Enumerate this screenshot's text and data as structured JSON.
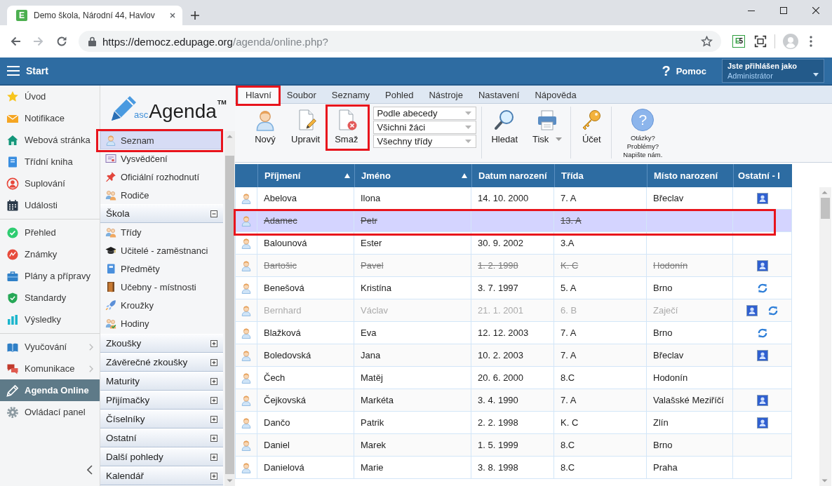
{
  "browser": {
    "tab": {
      "favicon": "E",
      "title": "Demo škola, Národní 44, Havlov"
    },
    "url": {
      "host": "https://democz.edupage.org",
      "path": "/agenda/online.php?"
    },
    "extension": "E5"
  },
  "app_bar": {
    "start": "Start",
    "help": {
      "glyph": "?",
      "label": "Pomoc"
    },
    "user": {
      "caption": "Jste přihlášen jako",
      "name": "Administrátor"
    }
  },
  "main_nav": {
    "groups": [
      [
        {
          "label": "Úvod",
          "selected": false,
          "submenu": false
        },
        {
          "label": "Notifikace",
          "selected": false,
          "submenu": false
        },
        {
          "label": "Webová stránka",
          "selected": false,
          "submenu": false
        },
        {
          "label": "Třídní kniha",
          "selected": false,
          "submenu": false
        },
        {
          "label": "Suplování",
          "selected": false,
          "submenu": false
        },
        {
          "label": "Události",
          "selected": false,
          "submenu": false
        }
      ],
      [
        {
          "label": "Přehled",
          "selected": false,
          "submenu": false
        },
        {
          "label": "Známky",
          "selected": false,
          "submenu": false
        },
        {
          "label": "Plány a přípravy",
          "selected": false,
          "submenu": false
        },
        {
          "label": "Standardy",
          "selected": false,
          "submenu": false
        },
        {
          "label": "Výsledky",
          "selected": false,
          "submenu": false
        }
      ],
      [
        {
          "label": "Vyučování",
          "selected": false,
          "submenu": true
        },
        {
          "label": "Komunikace",
          "selected": false,
          "submenu": true
        },
        {
          "label": "Agenda Online",
          "selected": true,
          "submenu": false
        },
        {
          "label": "Ovládací panel",
          "selected": false,
          "submenu": false
        }
      ]
    ]
  },
  "agenda_panel": {
    "logo": {
      "prefix": "asc",
      "name": "Agenda",
      "mark": "TM"
    },
    "items": [
      {
        "label": "Seznam",
        "selected": true,
        "highlighted": true
      },
      {
        "label": "Vysvědčení",
        "selected": false,
        "highlighted": false
      },
      {
        "label": "Oficiální rozhodnutí",
        "selected": false,
        "highlighted": false
      },
      {
        "label": "Rodiče",
        "selected": false,
        "highlighted": false
      }
    ],
    "groups": [
      {
        "label": "Škola",
        "expanded": true,
        "items": [
          {
            "label": "Třídy",
            "selected": false
          },
          {
            "label": "Učitelé - zaměstnanci",
            "selected": false
          },
          {
            "label": "Předměty",
            "selected": false
          },
          {
            "label": "Učebny - místnosti",
            "selected": false
          },
          {
            "label": "Kroužky",
            "selected": false
          },
          {
            "label": "Hodiny",
            "selected": false
          }
        ]
      },
      {
        "label": "Zkoušky",
        "expanded": false
      },
      {
        "label": "Závěrečné zkoušky",
        "expanded": false
      },
      {
        "label": "Maturity",
        "expanded": false
      },
      {
        "label": "Přijímačky",
        "expanded": false
      },
      {
        "label": "Číselníky",
        "expanded": false
      },
      {
        "label": "Ostatní",
        "expanded": false
      },
      {
        "label": "Další pohledy",
        "expanded": false
      },
      {
        "label": "Kalendář",
        "expanded": false
      }
    ]
  },
  "ribbon": {
    "tabs": [
      {
        "label": "Hlavní",
        "selected": true,
        "highlighted": true
      },
      {
        "label": "Soubor",
        "selected": false,
        "highlighted": false
      },
      {
        "label": "Seznamy",
        "selected": false,
        "highlighted": false
      },
      {
        "label": "Pohled",
        "selected": false,
        "highlighted": false
      },
      {
        "label": "Nástroje",
        "selected": false,
        "highlighted": false
      },
      {
        "label": "Nastavení",
        "selected": false,
        "highlighted": false
      },
      {
        "label": "Nápověda",
        "selected": false,
        "highlighted": false
      }
    ],
    "tools": [
      {
        "kind": "new",
        "label": "Nový",
        "highlighted": false,
        "menu": false
      },
      {
        "kind": "edit",
        "label": "Upravit",
        "highlighted": false,
        "menu": false
      },
      {
        "kind": "delete",
        "label": "Smaž",
        "highlighted": true,
        "menu": false
      },
      {
        "kind": "select",
        "value": "Podle abecedy"
      },
      {
        "kind": "select",
        "value": "Všichni žáci"
      },
      {
        "kind": "select",
        "value": "Všechny třídy"
      },
      {
        "kind": "separator"
      },
      {
        "kind": "search",
        "label": "Hledat",
        "highlighted": false,
        "menu": false
      },
      {
        "kind": "print",
        "label": "Tisk",
        "highlighted": false,
        "menu": true
      },
      {
        "kind": "separator"
      },
      {
        "kind": "account",
        "label": "Účet",
        "highlighted": false,
        "menu": false
      },
      {
        "kind": "separator"
      },
      {
        "kind": "help",
        "glyph": "?",
        "lines": [
          "Otázky?",
          "Problémy?",
          "Napište nám."
        ]
      }
    ]
  },
  "table": {
    "columns": [
      {
        "label": "Příjmení",
        "sorted": true
      },
      {
        "label": "Jméno",
        "sorted": true
      },
      {
        "label": "Datum narození",
        "sorted": false
      },
      {
        "label": "Třída",
        "sorted": false
      },
      {
        "label": "Místo narození",
        "sorted": false
      },
      {
        "label": "Ostatní - I",
        "sorted": false
      }
    ],
    "rows": [
      {
        "surname": "Abelova",
        "first_name": "Ilona",
        "birth_date": "14. 10. 2000",
        "class": "7. A",
        "birthplace": "Břeclav",
        "deleted": false,
        "inactive": false,
        "selected": false,
        "highlighted": false,
        "other": [
          {
            "kind": "card"
          }
        ]
      },
      {
        "surname": "Adamec",
        "first_name": "Petr",
        "class": "13. A",
        "deleted": true,
        "inactive": false,
        "selected": true,
        "highlighted": true
      },
      {
        "surname": "Balounová",
        "first_name": "Ester",
        "birth_date": "30. 9. 2002",
        "class": "3.A",
        "deleted": false,
        "inactive": false,
        "selected": false,
        "highlighted": false
      },
      {
        "surname": "Bartošic",
        "first_name": "Pavel",
        "birth_date": "1. 2. 1998",
        "class": "K. C",
        "birthplace": "Hodonín",
        "deleted": true,
        "inactive": false,
        "selected": false,
        "highlighted": false,
        "other": [
          {
            "kind": "card"
          }
        ]
      },
      {
        "surname": "Benešová",
        "first_name": "Kristína",
        "birth_date": "3. 7. 1997",
        "class": "5. A",
        "birthplace": "Brno",
        "deleted": false,
        "inactive": false,
        "selected": false,
        "highlighted": false,
        "other": [
          {
            "kind": "sync"
          }
        ]
      },
      {
        "surname": "Bernhard",
        "first_name": "Václav",
        "birth_date": "21. 1. 2001",
        "class": "6. B",
        "birthplace": "Zaječí",
        "deleted": false,
        "inactive": true,
        "selected": false,
        "highlighted": false,
        "other": [
          {
            "kind": "card"
          },
          {
            "kind": "sync"
          }
        ]
      },
      {
        "surname": "Blažková",
        "first_name": "Eva",
        "birth_date": "12. 12. 2003",
        "class": "7. A",
        "birthplace": "Brno",
        "deleted": false,
        "inactive": false,
        "selected": false,
        "highlighted": false,
        "other": [
          {
            "kind": "sync"
          }
        ]
      },
      {
        "surname": "Boledovská",
        "first_name": "Jana",
        "birth_date": "10. 2. 2003",
        "class": "7. A",
        "birthplace": "Břeclav",
        "deleted": false,
        "inactive": false,
        "selected": false,
        "highlighted": false,
        "other": [
          {
            "kind": "card"
          }
        ]
      },
      {
        "surname": "Čech",
        "first_name": "Matěj",
        "birth_date": "20. 6. 2000",
        "class": "8.C",
        "birthplace": "Hodonín",
        "deleted": false,
        "inactive": false,
        "selected": false,
        "highlighted": false
      },
      {
        "surname": "Čejkovská",
        "first_name": "Markéta",
        "birth_date": "3. 4. 1990",
        "class": "7. A",
        "birthplace": "Valašské Meziříčí",
        "deleted": false,
        "inactive": false,
        "selected": false,
        "highlighted": false,
        "other": [
          {
            "kind": "card"
          }
        ]
      },
      {
        "surname": "Dančo",
        "first_name": "Patrik",
        "birth_date": "2. 2. 1998",
        "class": "K. C",
        "birthplace": "Zlín",
        "deleted": false,
        "inactive": false,
        "selected": false,
        "highlighted": false,
        "other": [
          {
            "kind": "card"
          }
        ]
      },
      {
        "surname": "Daniel",
        "first_name": "Marek",
        "birth_date": "1. 5. 1999",
        "class": "8.C",
        "birthplace": "Brno",
        "deleted": false,
        "inactive": false,
        "selected": false,
        "highlighted": false
      },
      {
        "surname": "Danielová",
        "first_name": "Marie",
        "birth_date": "3. 8. 1998",
        "class": "8.C",
        "birthplace": "Praha",
        "deleted": false,
        "inactive": false,
        "selected": false,
        "highlighted": false
      }
    ]
  }
}
